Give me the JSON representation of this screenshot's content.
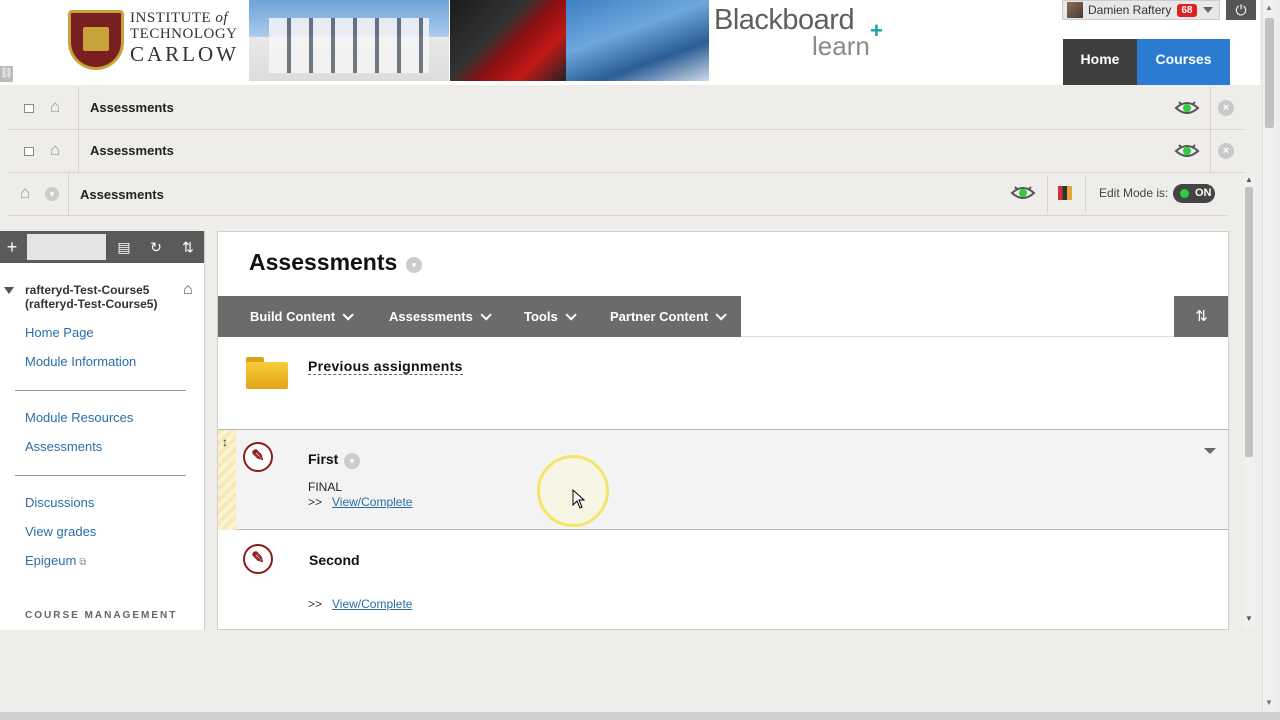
{
  "header": {
    "logo_line1_a": "INSTITUTE",
    "logo_line1_b": "of",
    "logo_line2": "TECHNOLOGY",
    "logo_line3": "CARLOW",
    "brand_name": "Blackboard",
    "brand_sub": "learn",
    "brand_plus": "+"
  },
  "user": {
    "name": "Damien Raftery",
    "notifications": "68",
    "power_icon": "⏻"
  },
  "nav": {
    "home": "Home",
    "courses": "Courses"
  },
  "breadcrumbs": [
    {
      "label": "Assessments"
    },
    {
      "label": "Assessments"
    },
    {
      "label": "Assessments"
    }
  ],
  "edit_mode": {
    "label": "Edit Mode is:",
    "value": "ON"
  },
  "left_panel": {
    "course_title": "rafteryd-Test-Course5 (rafteryd-Test-Course5)",
    "links_group1": [
      "Home Page",
      "Module Information"
    ],
    "links_group2": [
      "Module Resources",
      "Assessments"
    ],
    "links_group3": [
      "Discussions",
      "View grades",
      "Epigeum"
    ],
    "section_header": "COURSE MANAGEMENT"
  },
  "content": {
    "title": "Assessments",
    "menus": [
      "Build Content",
      "Assessments",
      "Tools",
      "Partner Content"
    ],
    "items": [
      {
        "type": "folder",
        "title": "Previous assignments"
      },
      {
        "type": "test",
        "title": "First",
        "description": "FINAL",
        "prefix": ">>",
        "action": "View/Complete"
      },
      {
        "type": "test",
        "title": "Second",
        "description": "",
        "prefix": ">>",
        "action": "View/Complete"
      }
    ]
  },
  "colors": {
    "nav_courses": "#2a7bd1",
    "nav_home": "#3f3f3f",
    "action_bar": "#6b6b6b",
    "link": "#2a6ea8",
    "toggle_on": "#2ecc40"
  }
}
